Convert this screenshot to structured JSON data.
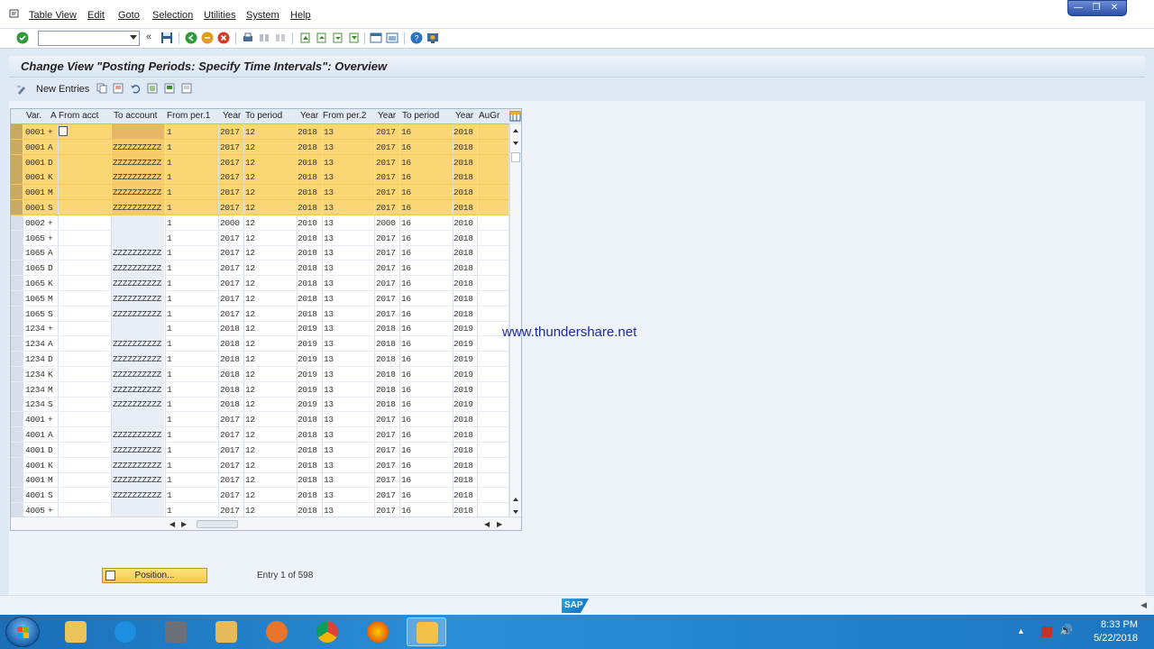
{
  "menu": {
    "items": [
      "Table View",
      "Edit",
      "Goto",
      "Selection",
      "Utilities",
      "System",
      "Help"
    ]
  },
  "window": {
    "title": "Change View \"Posting Periods: Specify Time Intervals\": Overview"
  },
  "app_toolbar": {
    "new_entries_label": "New Entries"
  },
  "table": {
    "headers": [
      "Var.",
      "A",
      "From acct",
      "To account",
      "From per.1",
      "Year",
      "To period",
      "Year",
      "From per.2",
      "Year",
      "To period",
      "Year",
      "AuGr"
    ],
    "rows": [
      {
        "var": "0001",
        "a": "+",
        "from_acct": "",
        "to_acct": "",
        "fp1": "1",
        "y1": "2017",
        "tp1": "12",
        "y2": "2018",
        "fp2": "13",
        "y3": "2017",
        "tp2": "16",
        "y4": "2018",
        "selected": true
      },
      {
        "var": "0001",
        "a": "A",
        "from_acct": "",
        "to_acct": "ZZZZZZZZZZ",
        "fp1": "1",
        "y1": "2017",
        "tp1": "12",
        "y2": "2018",
        "fp2": "13",
        "y3": "2017",
        "tp2": "16",
        "y4": "2018",
        "selected": true
      },
      {
        "var": "0001",
        "a": "D",
        "from_acct": "",
        "to_acct": "ZZZZZZZZZZ",
        "fp1": "1",
        "y1": "2017",
        "tp1": "12",
        "y2": "2018",
        "fp2": "13",
        "y3": "2017",
        "tp2": "16",
        "y4": "2018",
        "selected": true
      },
      {
        "var": "0001",
        "a": "K",
        "from_acct": "",
        "to_acct": "ZZZZZZZZZZ",
        "fp1": "1",
        "y1": "2017",
        "tp1": "12",
        "y2": "2018",
        "fp2": "13",
        "y3": "2017",
        "tp2": "16",
        "y4": "2018",
        "selected": true
      },
      {
        "var": "0001",
        "a": "M",
        "from_acct": "",
        "to_acct": "ZZZZZZZZZZ",
        "fp1": "1",
        "y1": "2017",
        "tp1": "12",
        "y2": "2018",
        "fp2": "13",
        "y3": "2017",
        "tp2": "16",
        "y4": "2018",
        "selected": true
      },
      {
        "var": "0001",
        "a": "S",
        "from_acct": "",
        "to_acct": "ZZZZZZZZZZ",
        "fp1": "1",
        "y1": "2017",
        "tp1": "12",
        "y2": "2018",
        "fp2": "13",
        "y3": "2017",
        "tp2": "16",
        "y4": "2018",
        "selected": true
      },
      {
        "var": "0002",
        "a": "+",
        "from_acct": "",
        "to_acct": "",
        "fp1": "1",
        "y1": "2000",
        "tp1": "12",
        "y2": "2010",
        "fp2": "13",
        "y3": "2000",
        "tp2": "16",
        "y4": "2010",
        "selected": false
      },
      {
        "var": "1065",
        "a": "+",
        "from_acct": "",
        "to_acct": "",
        "fp1": "1",
        "y1": "2017",
        "tp1": "12",
        "y2": "2018",
        "fp2": "13",
        "y3": "2017",
        "tp2": "16",
        "y4": "2018",
        "selected": false
      },
      {
        "var": "1065",
        "a": "A",
        "from_acct": "",
        "to_acct": "ZZZZZZZZZZ",
        "fp1": "1",
        "y1": "2017",
        "tp1": "12",
        "y2": "2018",
        "fp2": "13",
        "y3": "2017",
        "tp2": "16",
        "y4": "2018",
        "selected": false
      },
      {
        "var": "1065",
        "a": "D",
        "from_acct": "",
        "to_acct": "ZZZZZZZZZZ",
        "fp1": "1",
        "y1": "2017",
        "tp1": "12",
        "y2": "2018",
        "fp2": "13",
        "y3": "2017",
        "tp2": "16",
        "y4": "2018",
        "selected": false
      },
      {
        "var": "1065",
        "a": "K",
        "from_acct": "",
        "to_acct": "ZZZZZZZZZZ",
        "fp1": "1",
        "y1": "2017",
        "tp1": "12",
        "y2": "2018",
        "fp2": "13",
        "y3": "2017",
        "tp2": "16",
        "y4": "2018",
        "selected": false
      },
      {
        "var": "1065",
        "a": "M",
        "from_acct": "",
        "to_acct": "ZZZZZZZZZZ",
        "fp1": "1",
        "y1": "2017",
        "tp1": "12",
        "y2": "2018",
        "fp2": "13",
        "y3": "2017",
        "tp2": "16",
        "y4": "2018",
        "selected": false
      },
      {
        "var": "1065",
        "a": "S",
        "from_acct": "",
        "to_acct": "ZZZZZZZZZZ",
        "fp1": "1",
        "y1": "2017",
        "tp1": "12",
        "y2": "2018",
        "fp2": "13",
        "y3": "2017",
        "tp2": "16",
        "y4": "2018",
        "selected": false
      },
      {
        "var": "1234",
        "a": "+",
        "from_acct": "",
        "to_acct": "",
        "fp1": "1",
        "y1": "2018",
        "tp1": "12",
        "y2": "2019",
        "fp2": "13",
        "y3": "2018",
        "tp2": "16",
        "y4": "2019",
        "selected": false
      },
      {
        "var": "1234",
        "a": "A",
        "from_acct": "",
        "to_acct": "ZZZZZZZZZZ",
        "fp1": "1",
        "y1": "2018",
        "tp1": "12",
        "y2": "2019",
        "fp2": "13",
        "y3": "2018",
        "tp2": "16",
        "y4": "2019",
        "selected": false
      },
      {
        "var": "1234",
        "a": "D",
        "from_acct": "",
        "to_acct": "ZZZZZZZZZZ",
        "fp1": "1",
        "y1": "2018",
        "tp1": "12",
        "y2": "2019",
        "fp2": "13",
        "y3": "2018",
        "tp2": "16",
        "y4": "2019",
        "selected": false
      },
      {
        "var": "1234",
        "a": "K",
        "from_acct": "",
        "to_acct": "ZZZZZZZZZZ",
        "fp1": "1",
        "y1": "2018",
        "tp1": "12",
        "y2": "2019",
        "fp2": "13",
        "y3": "2018",
        "tp2": "16",
        "y4": "2019",
        "selected": false
      },
      {
        "var": "1234",
        "a": "M",
        "from_acct": "",
        "to_acct": "ZZZZZZZZZZ",
        "fp1": "1",
        "y1": "2018",
        "tp1": "12",
        "y2": "2019",
        "fp2": "13",
        "y3": "2018",
        "tp2": "16",
        "y4": "2019",
        "selected": false
      },
      {
        "var": "1234",
        "a": "S",
        "from_acct": "",
        "to_acct": "ZZZZZZZZZZ",
        "fp1": "1",
        "y1": "2018",
        "tp1": "12",
        "y2": "2019",
        "fp2": "13",
        "y3": "2018",
        "tp2": "16",
        "y4": "2019",
        "selected": false
      },
      {
        "var": "4001",
        "a": "+",
        "from_acct": "",
        "to_acct": "",
        "fp1": "1",
        "y1": "2017",
        "tp1": "12",
        "y2": "2018",
        "fp2": "13",
        "y3": "2017",
        "tp2": "16",
        "y4": "2018",
        "selected": false
      },
      {
        "var": "4001",
        "a": "A",
        "from_acct": "",
        "to_acct": "ZZZZZZZZZZ",
        "fp1": "1",
        "y1": "2017",
        "tp1": "12",
        "y2": "2018",
        "fp2": "13",
        "y3": "2017",
        "tp2": "16",
        "y4": "2018",
        "selected": false
      },
      {
        "var": "4001",
        "a": "D",
        "from_acct": "",
        "to_acct": "ZZZZZZZZZZ",
        "fp1": "1",
        "y1": "2017",
        "tp1": "12",
        "y2": "2018",
        "fp2": "13",
        "y3": "2017",
        "tp2": "16",
        "y4": "2018",
        "selected": false
      },
      {
        "var": "4001",
        "a": "K",
        "from_acct": "",
        "to_acct": "ZZZZZZZZZZ",
        "fp1": "1",
        "y1": "2017",
        "tp1": "12",
        "y2": "2018",
        "fp2": "13",
        "y3": "2017",
        "tp2": "16",
        "y4": "2018",
        "selected": false
      },
      {
        "var": "4001",
        "a": "M",
        "from_acct": "",
        "to_acct": "ZZZZZZZZZZ",
        "fp1": "1",
        "y1": "2017",
        "tp1": "12",
        "y2": "2018",
        "fp2": "13",
        "y3": "2017",
        "tp2": "16",
        "y4": "2018",
        "selected": false
      },
      {
        "var": "4001",
        "a": "S",
        "from_acct": "",
        "to_acct": "ZZZZZZZZZZ",
        "fp1": "1",
        "y1": "2017",
        "tp1": "12",
        "y2": "2018",
        "fp2": "13",
        "y3": "2017",
        "tp2": "16",
        "y4": "2018",
        "selected": false
      },
      {
        "var": "4005",
        "a": "+",
        "from_acct": "",
        "to_acct": "",
        "fp1": "1",
        "y1": "2017",
        "tp1": "12",
        "y2": "2018",
        "fp2": "13",
        "y3": "2017",
        "tp2": "16",
        "y4": "2018",
        "selected": false
      }
    ]
  },
  "footer": {
    "position_label": "Position...",
    "entry_text": "Entry 1 of 598"
  },
  "watermark": "www.thundershare.net",
  "taskbar": {
    "time": "8:33 PM",
    "date": "5/22/2018"
  },
  "colors": {
    "selected_row": "#fbd675",
    "title_bg": "#dae5f3",
    "taskbar": "#1c76c2"
  }
}
